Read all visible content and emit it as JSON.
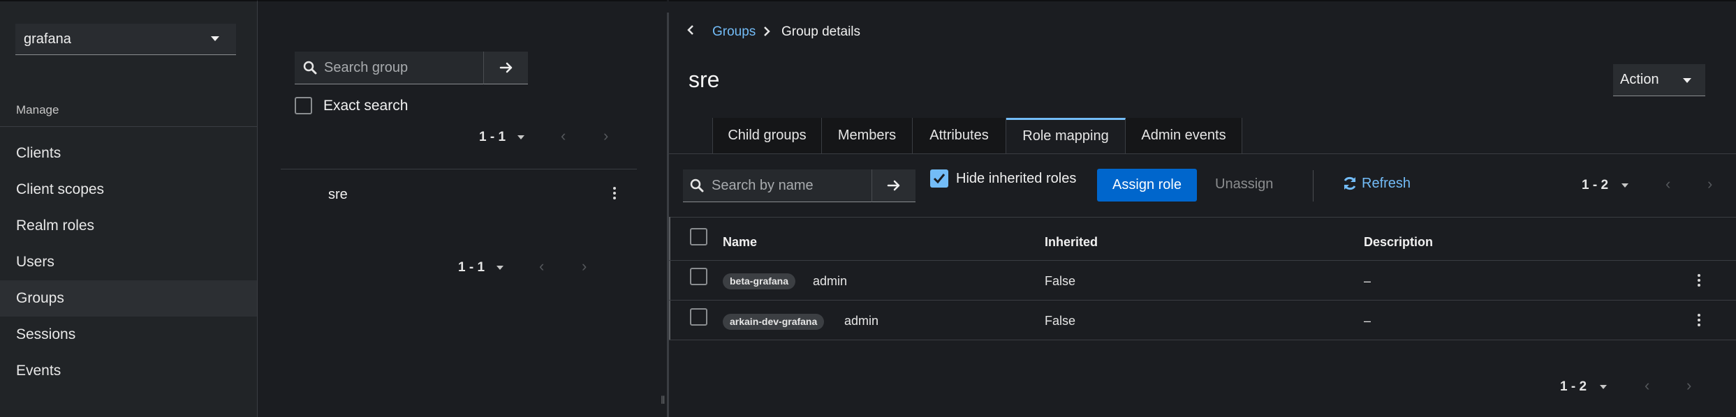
{
  "sidebar": {
    "realm": "grafana",
    "section_label": "Manage",
    "items": [
      {
        "label": "Clients"
      },
      {
        "label": "Client scopes"
      },
      {
        "label": "Realm roles"
      },
      {
        "label": "Users"
      },
      {
        "label": "Groups"
      },
      {
        "label": "Sessions"
      },
      {
        "label": "Events"
      }
    ],
    "active_item": "Groups"
  },
  "groups_panel": {
    "search_placeholder": "Search group",
    "exact_search_label": "Exact search",
    "exact_search_checked": false,
    "pagination_top": "1 - 1",
    "pagination_bottom": "1 - 1",
    "groups": [
      {
        "name": "sre"
      }
    ]
  },
  "breadcrumb": {
    "parent": "Groups",
    "current": "Group details"
  },
  "group": {
    "name": "sre",
    "action_label": "Action"
  },
  "tabs": [
    {
      "label": "Child groups"
    },
    {
      "label": "Members"
    },
    {
      "label": "Attributes"
    },
    {
      "label": "Role mapping"
    },
    {
      "label": "Admin events"
    }
  ],
  "active_tab": "Role mapping",
  "toolbar": {
    "search_placeholder": "Search by name",
    "hide_inherited_label": "Hide inherited roles",
    "hide_inherited_checked": true,
    "assign_label": "Assign role",
    "unassign_label": "Unassign",
    "refresh_label": "Refresh",
    "pagination": "1 - 2"
  },
  "table": {
    "columns": [
      "Name",
      "Inherited",
      "Description"
    ],
    "rows": [
      {
        "client": "beta-grafana",
        "role": "admin",
        "inherited": "False",
        "description": "–"
      },
      {
        "client": "arkain-dev-grafana",
        "role": "admin",
        "inherited": "False",
        "description": "–"
      }
    ],
    "pagination_bottom": "1 - 2"
  },
  "colors": {
    "accent": "#73bcf7",
    "primary_button": "#0066cc",
    "background": "#1b1d21",
    "sidebar": "#212427"
  }
}
